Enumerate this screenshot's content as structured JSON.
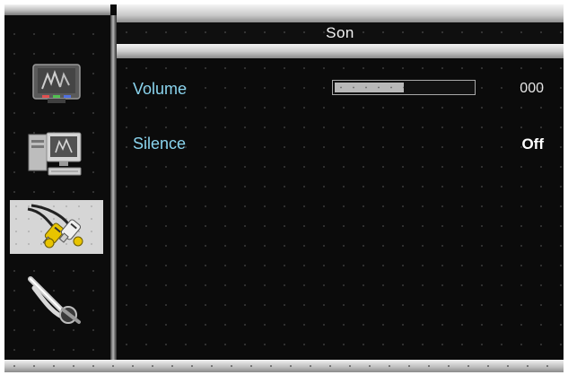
{
  "menu": {
    "title": "Son",
    "sidebar": {
      "items": [
        {
          "icon": "picture-tv-icon",
          "selected": false
        },
        {
          "icon": "pc-computer-icon",
          "selected": false
        },
        {
          "icon": "rca-audio-cables-icon",
          "selected": true
        },
        {
          "icon": "tools-pliers-icon",
          "selected": false
        }
      ]
    },
    "rows": [
      {
        "label": "Volume",
        "value": "000",
        "level_fraction": 0.5
      },
      {
        "label": "Silence",
        "value": "Off"
      }
    ]
  },
  "colors": {
    "label": "#8ad4ee",
    "background": "#0b0b0b",
    "selected_item": "#d6d6d6"
  }
}
